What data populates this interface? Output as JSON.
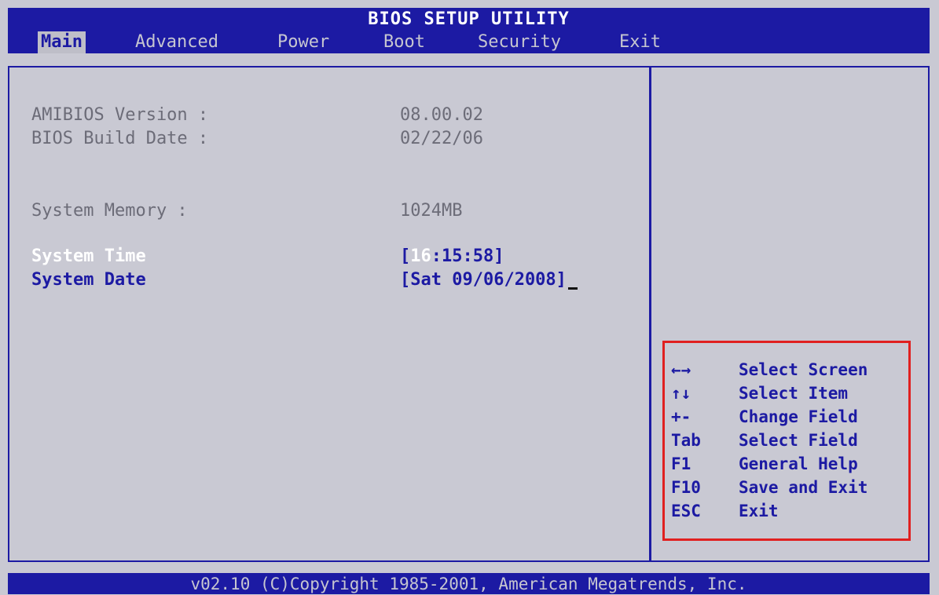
{
  "header": {
    "title": "BIOS SETUP UTILITY",
    "tabs": [
      {
        "label": "Main",
        "active": true
      },
      {
        "label": "Advanced"
      },
      {
        "label": "Power"
      },
      {
        "label": "Boot"
      },
      {
        "label": "Security"
      },
      {
        "label": "Exit"
      }
    ]
  },
  "main": {
    "amibios_label": "AMIBIOS Version :",
    "amibios_value": "08.00.02",
    "build_label": "BIOS Build Date :",
    "build_value": "02/22/06",
    "memory_label": "System Memory   :",
    "memory_value": "1024MB",
    "time_label": "System Time",
    "time_open": "[",
    "time_hours": "16",
    "time_rest": ":15:58]",
    "date_label": "System Date",
    "date_value": "[Sat 09/06/2008]"
  },
  "help": {
    "items": [
      {
        "key": "←→",
        "action": "Select Screen"
      },
      {
        "key": "↑↓",
        "action": "Select Item"
      },
      {
        "key": "+-",
        "action": "Change Field"
      },
      {
        "key": "Tab",
        "action": "Select Field"
      },
      {
        "key": "F1",
        "action": "General Help"
      },
      {
        "key": "F10",
        "action": "Save and Exit"
      },
      {
        "key": "ESC",
        "action": "Exit"
      }
    ]
  },
  "footer": {
    "text": "v02.10 (C)Copyright 1985-2001, American Megatrends, Inc."
  },
  "colors": {
    "background": "#c9c9d3",
    "bar": "#1c1aa3",
    "highlight_box": "#e02020"
  }
}
